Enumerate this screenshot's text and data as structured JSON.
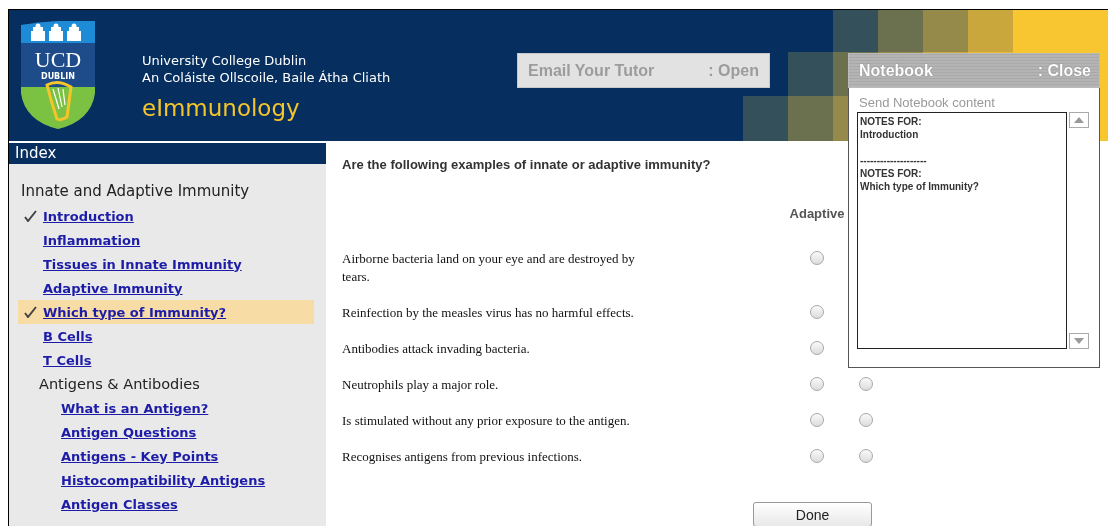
{
  "header": {
    "logo": {
      "title": "UCD",
      "subtitle": "DUBLIN"
    },
    "institution": [
      "University College Dublin",
      "An Coláiste Ollscoile, Baile Átha Cliath"
    ],
    "course": "eImmunology"
  },
  "email_tutor": {
    "label": "Email Your Tutor",
    "action": ": Open"
  },
  "notebook": {
    "title": "Notebook",
    "action": ": Close",
    "send_label": "Send Notebook content",
    "notes": "NOTES FOR:\nIntroduction\n\n--------------------\nNOTES FOR:\nWhich type of Immunity?"
  },
  "index": {
    "title": "Index",
    "sections": [
      {
        "title": "Innate and Adaptive Immunity",
        "children": [
          {
            "label": "Introduction",
            "checked": true,
            "selected": false
          },
          {
            "label": "Inflammation",
            "checked": false,
            "selected": false
          },
          {
            "label": "Tissues in Innate Immunity",
            "checked": false,
            "selected": false
          },
          {
            "label": "Adaptive Immunity",
            "checked": false,
            "selected": false
          },
          {
            "label": "Which type of Immunity?",
            "checked": true,
            "selected": true
          },
          {
            "label": "B Cells",
            "checked": false,
            "selected": false
          },
          {
            "label": "T Cells",
            "checked": false,
            "selected": false
          },
          {
            "title": "Antigens & Antibodies",
            "children": [
              {
                "label": "What is an Antigen?",
                "checked": false,
                "selected": false
              },
              {
                "label": "Antigen Questions",
                "checked": false,
                "selected": false
              },
              {
                "label": "Antigens - Key Points",
                "checked": false,
                "selected": false
              },
              {
                "label": "Histocompatibility Antigens",
                "checked": false,
                "selected": false
              },
              {
                "label": "Antigen Classes",
                "checked": false,
                "selected": false
              }
            ]
          }
        ]
      }
    ]
  },
  "quiz": {
    "question": "Are the following examples of innate or adaptive immunity?",
    "columns": [
      "Adaptive"
    ],
    "rows": [
      {
        "text": "Airborne bacteria land on your eye and are destroyed by tears.",
        "choices": [
          {
            "selected": false
          }
        ]
      },
      {
        "text": "Reinfection by the measles virus has no harmful effects.",
        "choices": [
          {
            "selected": false
          }
        ]
      },
      {
        "text": "Antibodies attack invading bacteria.",
        "choices": [
          {
            "selected": false
          }
        ]
      },
      {
        "text": "Neutrophils play a major role.",
        "choices": [
          {
            "selected": false
          },
          {
            "selected": false
          }
        ]
      },
      {
        "text": "Is stimulated without any prior exposure to the antigen.",
        "choices": [
          {
            "selected": false
          },
          {
            "selected": false
          }
        ]
      },
      {
        "text": "Recognises antigens from previous infections.",
        "choices": [
          {
            "selected": false
          },
          {
            "selected": false
          }
        ]
      }
    ],
    "done": "Done"
  }
}
